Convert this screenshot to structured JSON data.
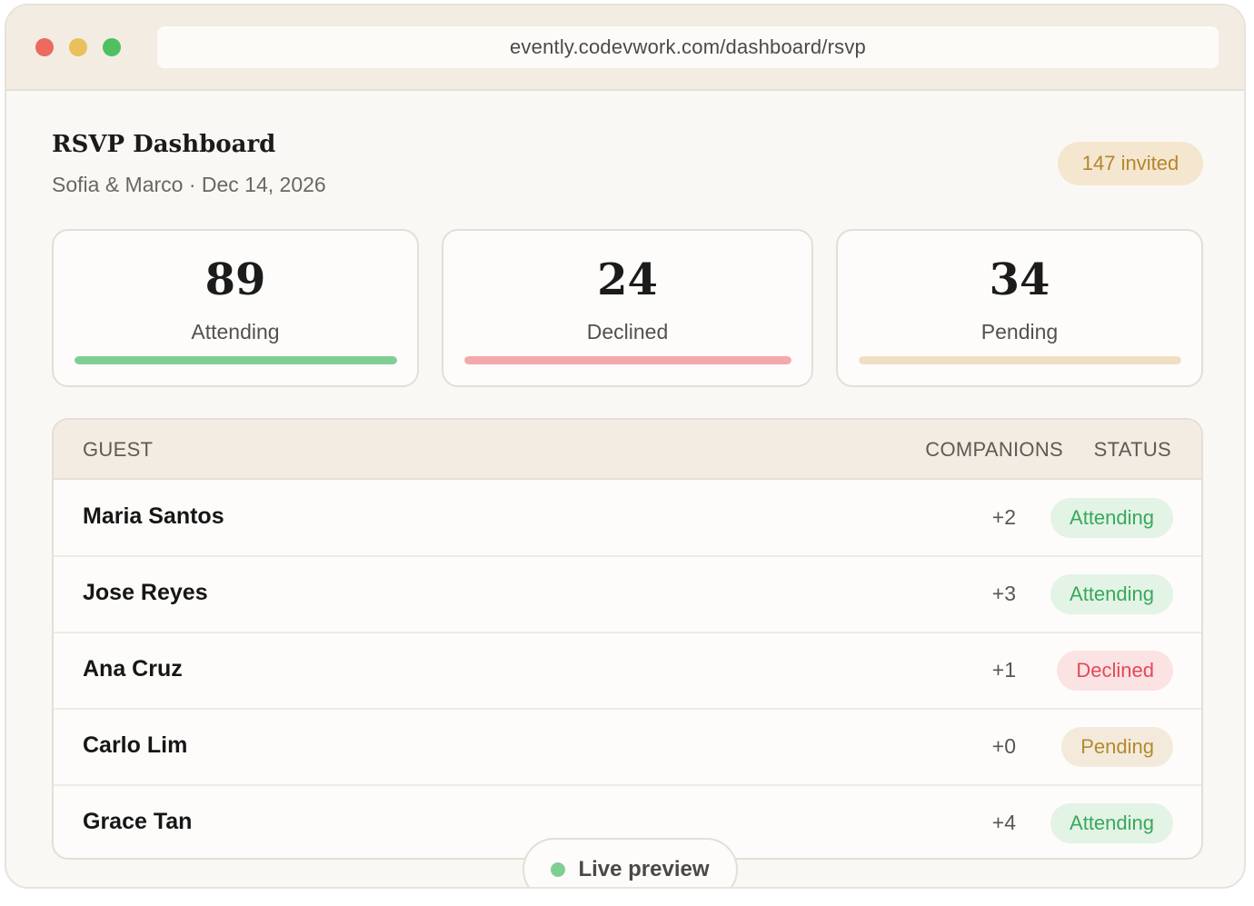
{
  "browser": {
    "url": "evently.codevwork.com/dashboard/rsvp"
  },
  "header": {
    "title": "RSVP Dashboard",
    "subtitle": "Sofia & Marco · Dec 14, 2026",
    "invited_badge": "147 invited"
  },
  "stats": [
    {
      "value": "89",
      "label": "Attending",
      "color": "#7fcf95",
      "fill": 1.0
    },
    {
      "value": "24",
      "label": "Declined",
      "color": "#f3a9ab",
      "fill": 1.0
    },
    {
      "value": "34",
      "label": "Pending",
      "color": "#efdfc4",
      "fill": 1.0
    }
  ],
  "table": {
    "headers": {
      "guest": "GUEST",
      "companions": "COMPANIONS",
      "status": "STATUS"
    },
    "rows": [
      {
        "name": "Maria Santos",
        "companions": "+2",
        "status": "Attending"
      },
      {
        "name": "Jose Reyes",
        "companions": "+3",
        "status": "Attending"
      },
      {
        "name": "Ana Cruz",
        "companions": "+1",
        "status": "Declined"
      },
      {
        "name": "Carlo Lim",
        "companions": "+0",
        "status": "Pending"
      },
      {
        "name": "Grace Tan",
        "companions": "+4",
        "status": "Attending"
      }
    ]
  },
  "status_colors": {
    "Attending": {
      "bg": "#e3f3e6",
      "fg": "#39a95a"
    },
    "Declined": {
      "bg": "#fbe2e3",
      "fg": "#e14a55"
    },
    "Pending": {
      "bg": "#f4eadb",
      "fg": "#b48a2c"
    }
  },
  "live_preview": {
    "label": "Live preview",
    "dot_color": "#7fcf95"
  }
}
